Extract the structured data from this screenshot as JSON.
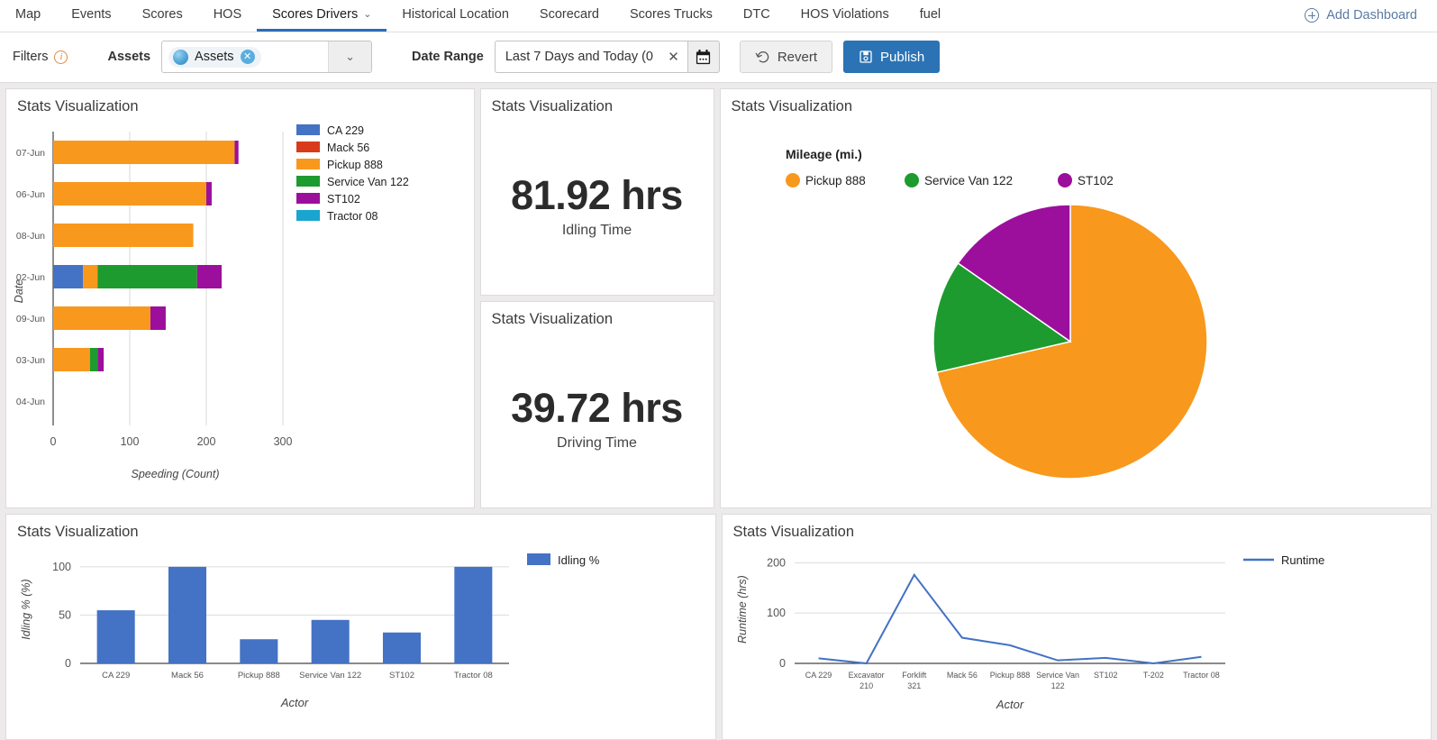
{
  "nav": {
    "tabs": [
      {
        "label": "Map",
        "active": false,
        "caret": false
      },
      {
        "label": "Events",
        "active": false,
        "caret": false
      },
      {
        "label": "Scores",
        "active": false,
        "caret": false
      },
      {
        "label": "HOS",
        "active": false,
        "caret": false
      },
      {
        "label": "Scores Drivers",
        "active": true,
        "caret": true
      },
      {
        "label": "Historical Location",
        "active": false,
        "caret": false
      },
      {
        "label": "Scorecard",
        "active": false,
        "caret": false
      },
      {
        "label": "Scores Trucks",
        "active": false,
        "caret": false
      },
      {
        "label": "DTC",
        "active": false,
        "caret": false
      },
      {
        "label": "HOS Violations",
        "active": false,
        "caret": false
      },
      {
        "label": "fuel",
        "active": false,
        "caret": false
      }
    ],
    "add_dashboard": "Add Dashboard"
  },
  "filters": {
    "label": "Filters",
    "assets_label": "Assets",
    "assets_chip": "Assets",
    "date_label": "Date Range",
    "date_value": "Last 7 Days and Today (0",
    "revert": "Revert",
    "publish": "Publish"
  },
  "cards": {
    "bar_title": "Stats Visualization",
    "stat1_title": "Stats Visualization",
    "stat2_title": "Stats Visualization",
    "pie_title": "Stats Visualization",
    "col_title": "Stats Visualization",
    "line_title": "Stats Visualization"
  },
  "stats": [
    {
      "value": "81.92 hrs",
      "label": "Idling Time"
    },
    {
      "value": "39.72 hrs",
      "label": "Driving Time"
    }
  ],
  "colors": {
    "ca229": "#4472c4",
    "mack56": "#d93a1c",
    "pickup888": "#f8981d",
    "servicevan122": "#1d9b2e",
    "st102": "#9c0f9c",
    "tractor08": "#1aa5d0",
    "accent": "#2b73b5",
    "line": "#4472c4"
  },
  "chart_data": [
    {
      "type": "bar",
      "orientation": "horizontal",
      "stacked": true,
      "title": "Stats Visualization",
      "xlabel": "Speeding (Count)",
      "ylabel": "Date",
      "xlim": [
        0,
        330
      ],
      "xticks": [
        0,
        100,
        200,
        300
      ],
      "categories": [
        "07-Jun",
        "06-Jun",
        "08-Jun",
        "02-Jun",
        "09-Jun",
        "03-Jun",
        "04-Jun"
      ],
      "legend_position": "right",
      "series": [
        {
          "name": "CA 229",
          "color": "#4472c4",
          "values": [
            0,
            0,
            0,
            39,
            0,
            0,
            0
          ]
        },
        {
          "name": "Mack 56",
          "color": "#d93a1c",
          "values": [
            0,
            0,
            0,
            0,
            0,
            0,
            0
          ]
        },
        {
          "name": "Pickup 888",
          "color": "#f8981d",
          "values": [
            237,
            200,
            183,
            19,
            127,
            48,
            0
          ]
        },
        {
          "name": "Service Van 122",
          "color": "#1d9b2e",
          "values": [
            0,
            0,
            0,
            130,
            0,
            10,
            0
          ]
        },
        {
          "name": "ST102",
          "color": "#9c0f9c",
          "values": [
            5,
            7,
            0,
            32,
            20,
            8,
            0
          ]
        },
        {
          "name": "Tractor 08",
          "color": "#1aa5d0",
          "values": [
            0,
            0,
            0,
            0,
            0,
            0,
            0
          ]
        }
      ]
    },
    {
      "type": "pie",
      "title": "Stats Visualization",
      "legend_title": "Mileage (mi.)",
      "legend_position": "top",
      "labels": [
        "Pickup 888",
        "Service Van 122",
        "ST102"
      ],
      "colors": [
        "#f8981d",
        "#1d9b2e",
        "#9c0f9c"
      ],
      "percentages": [
        71.4,
        13.3,
        15.3
      ]
    },
    {
      "type": "bar",
      "orientation": "vertical",
      "title": "Stats Visualization",
      "xlabel": "Actor",
      "ylabel": "Idling % (%)",
      "ylim": [
        0,
        112
      ],
      "yticks": [
        0,
        50,
        100
      ],
      "categories": [
        "CA 229",
        "Mack 56",
        "Pickup 888",
        "Service Van 122",
        "ST102",
        "Tractor 08"
      ],
      "legend_position": "right",
      "series": [
        {
          "name": "Idling %",
          "color": "#4472c4",
          "values": [
            55,
            100,
            25,
            45,
            32,
            100
          ]
        }
      ]
    },
    {
      "type": "line",
      "title": "Stats Visualization",
      "xlabel": "Actor",
      "ylabel": "Runtime (hrs)",
      "ylim": [
        0,
        215
      ],
      "yticks": [
        0,
        100,
        200
      ],
      "categories": [
        "CA 229",
        "Excavator 210",
        "Forklift 321",
        "Mack 56",
        "Pickup 888",
        "Service Van 122",
        "ST102",
        "T-202",
        "Tractor 08"
      ],
      "legend_position": "right",
      "series": [
        {
          "name": "Runtime",
          "color": "#4472c4",
          "values": [
            10,
            0,
            176,
            51,
            36,
            6,
            11,
            0,
            13
          ]
        }
      ]
    }
  ]
}
